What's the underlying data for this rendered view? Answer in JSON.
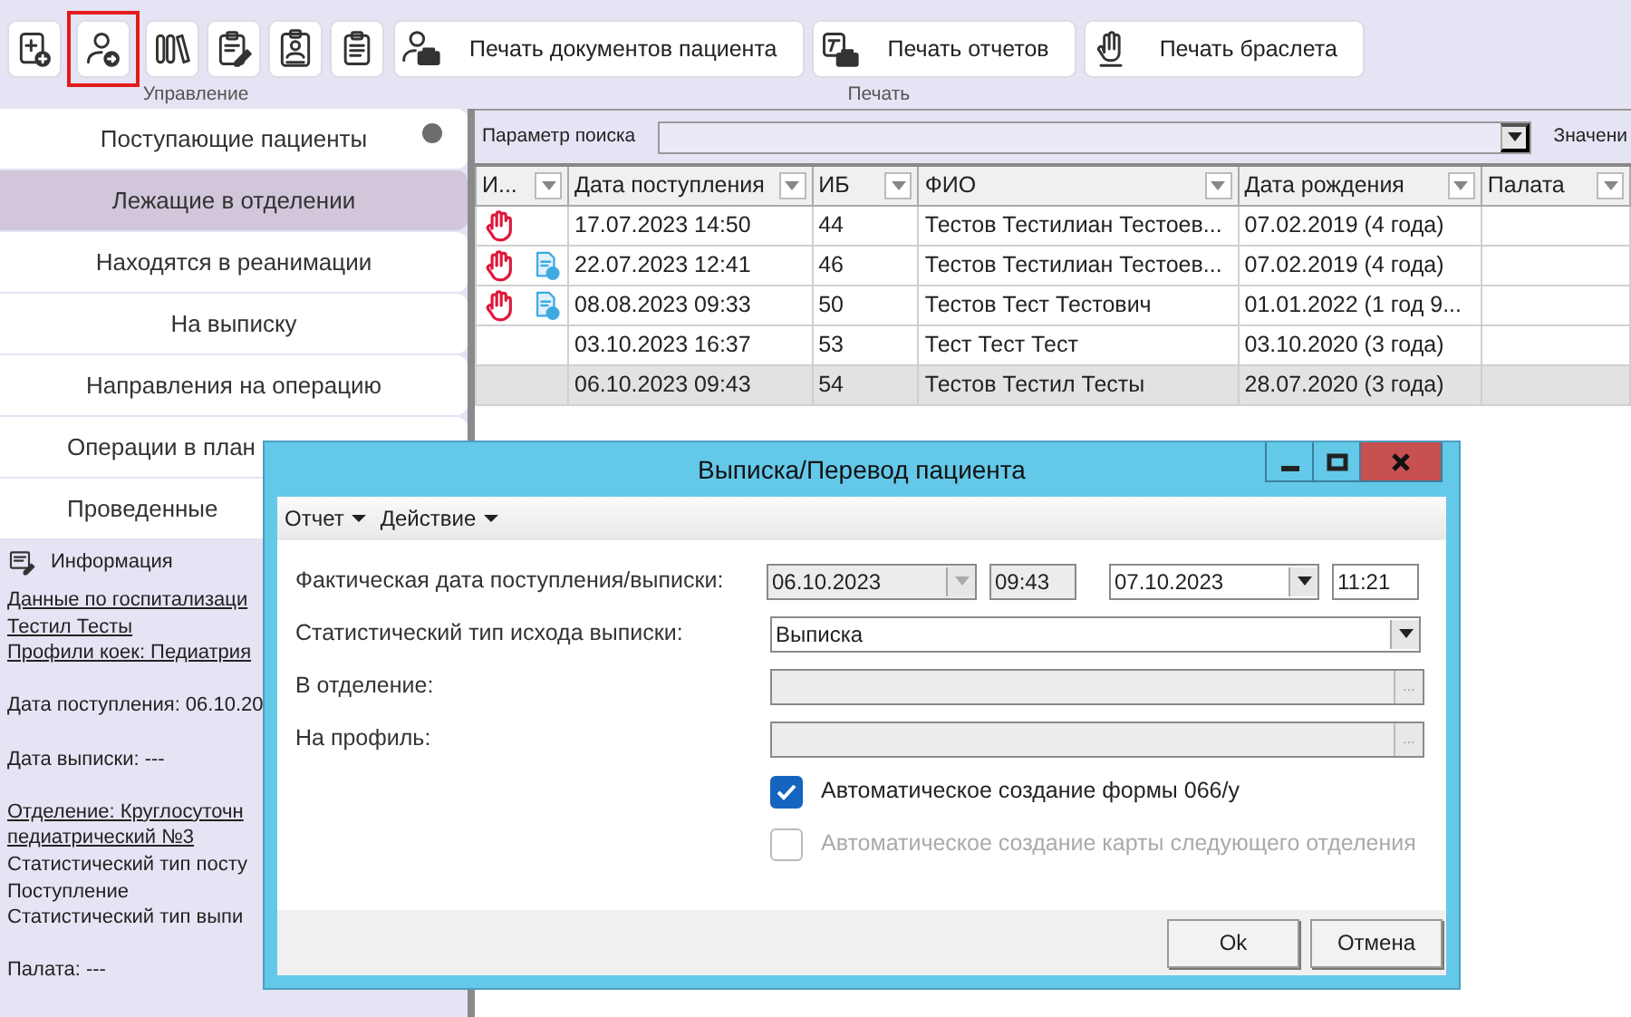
{
  "toolbar": {
    "groups": [
      {
        "label": "Управление",
        "buttons": [
          {
            "highlighted": false
          },
          {
            "highlighted": true
          },
          {
            "highlighted": false
          },
          {
            "highlighted": false
          },
          {
            "highlighted": false
          },
          {
            "highlighted": false
          }
        ]
      },
      {
        "label": "Печать",
        "buttons": [
          {
            "text": "Печать документов пациента",
            "highlighted": false
          },
          {
            "text": "Печать отчетов",
            "highlighted": false
          },
          {
            "text": "Печать браслета",
            "highlighted": false
          }
        ]
      }
    ]
  },
  "sidebar": {
    "items": [
      {
        "label": "Поступающие пациенты",
        "selected": false,
        "indicator": true
      },
      {
        "label": "Лежащие в отделении",
        "selected": true,
        "indicator": false
      },
      {
        "label": "Находятся в реанимации",
        "selected": false,
        "indicator": false
      },
      {
        "label": "На выписку",
        "selected": false,
        "indicator": false
      },
      {
        "label": "Направления на операцию",
        "selected": false,
        "indicator": false
      },
      {
        "label": "Операции в план",
        "selected": false,
        "indicator": false
      },
      {
        "label": "Проведенные",
        "selected": false,
        "indicator": false
      }
    ]
  },
  "info_panel": {
    "title": "Информация",
    "lines": [
      {
        "text": "Данные по госпитализаци",
        "kind": "link",
        "spaced": false
      },
      {
        "text": "Тестил Тесты",
        "kind": "link",
        "spaced": false
      },
      {
        "text": "Профили коек: Педиатрия",
        "kind": "link",
        "spaced": false
      },
      {
        "text": "Дата поступления: 06.10.20",
        "kind": "text",
        "spaced": true
      },
      {
        "text": "Дата выписки: ---",
        "kind": "text",
        "spaced": true
      },
      {
        "text": "Отделение: Круглосуточн",
        "kind": "link",
        "spaced": true
      },
      {
        "text": "педиатрический №3",
        "kind": "link",
        "spaced": false
      },
      {
        "text": "Статистический тип посту",
        "kind": "text",
        "spaced": false
      },
      {
        "text": "Поступление",
        "kind": "text",
        "spaced": false
      },
      {
        "text": "Статистический тип выпи",
        "kind": "text",
        "spaced": false
      },
      {
        "text": "Палата: ---",
        "kind": "text",
        "spaced": true
      }
    ]
  },
  "search": {
    "label": "Параметр поиска",
    "value_label": "Значени"
  },
  "table": {
    "icon_column": "И...",
    "columns": [
      "Дата поступления",
      "ИБ",
      "ФИО",
      "Дата рождения",
      "Палата"
    ],
    "rows": [
      {
        "alerts": [
          {
            "kind": "hand"
          }
        ],
        "cells": [
          "17.07.2023 14:50",
          "44",
          "Тестов  Тестилиан  Тестоев...",
          "07.02.2019 (4 года)"
        ],
        "selected": false
      },
      {
        "alerts": [
          {
            "kind": "hand"
          },
          {
            "kind": "document"
          }
        ],
        "cells": [
          "22.07.2023 12:41",
          "46",
          "Тестов  Тестилиан  Тестоев...",
          "07.02.2019 (4 года)"
        ],
        "selected": false
      },
      {
        "alerts": [
          {
            "kind": "hand"
          },
          {
            "kind": "document"
          }
        ],
        "cells": [
          "08.08.2023 09:33",
          "50",
          "Тестов Тест Тестович",
          "01.01.2022  (1  год 9..."
        ],
        "selected": false
      },
      {
        "cells": [
          "03.10.2023 16:37",
          "53",
          "Тест Тест Тест",
          "03.10.2020 (3 года)"
        ],
        "selected": false
      },
      {
        "cells": [
          "06.10.2023 09:43",
          "54",
          "Тестов Тестил Тесты",
          "28.07.2020 (3 года)"
        ],
        "selected": true
      }
    ]
  },
  "dialog": {
    "title": "Выписка/Перевод пациента",
    "menu": [
      "Отчет",
      "Действие"
    ],
    "fields": [
      {
        "label": "Фактическая дата поступления/выписки:",
        "kind": "datetime",
        "parts": [
          {
            "kind": "date",
            "value": "06.10.2023",
            "disabled": true
          },
          {
            "kind": "time",
            "value": "09:43",
            "disabled": true
          },
          {
            "kind": "date",
            "value": "07.10.2023",
            "disabled": false
          },
          {
            "kind": "time",
            "value": "11:21",
            "disabled": false
          }
        ]
      },
      {
        "label": "Статистический тип исхода выписки:",
        "kind": "select",
        "value": "Выписка"
      },
      {
        "label": "В отделение:",
        "kind": "lookup",
        "disabled": true,
        "button": "..."
      },
      {
        "label": "На профиль:",
        "kind": "lookup",
        "disabled": true,
        "button": "..."
      }
    ],
    "checkboxes": [
      {
        "label": "Автоматическое создание формы 066/у",
        "checked": true,
        "disabled": false
      },
      {
        "label": "Автоматическое создание карты следующего отделения",
        "checked": false,
        "disabled": true
      }
    ],
    "buttons": [
      "Ok",
      "Отмена"
    ]
  }
}
